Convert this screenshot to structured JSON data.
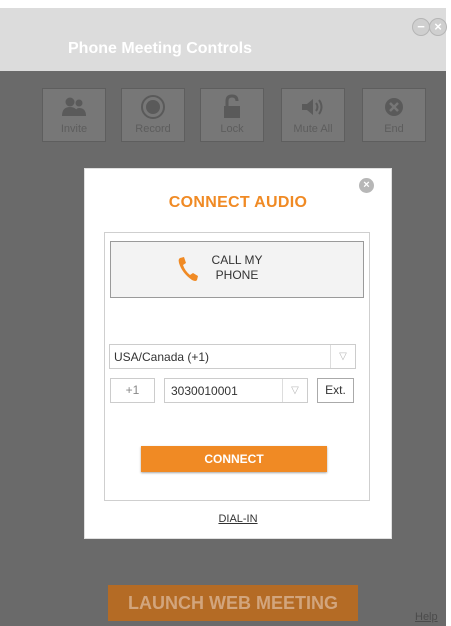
{
  "window": {
    "title": "Phone Meeting Controls",
    "minimize_symbol": "−",
    "close_symbol": "×"
  },
  "toolbar": {
    "items": [
      {
        "label": "Invite",
        "icon": "users-icon"
      },
      {
        "label": "Record",
        "icon": "record-icon"
      },
      {
        "label": "Lock",
        "icon": "unlock-icon"
      },
      {
        "label": "Mute All",
        "icon": "speaker-icon"
      },
      {
        "label": "End",
        "icon": "end-icon"
      }
    ]
  },
  "dialog": {
    "title": "CONNECT AUDIO",
    "close_symbol": "×",
    "call_my_phone_line1": "CALL MY",
    "call_my_phone_line2": "PHONE",
    "country_value": "USA/Canada (+1)",
    "country_code": "+1",
    "phone_number": "3030010001",
    "ext_label": "Ext.",
    "connect_label": "CONNECT",
    "dial_in_label": "DIAL-IN"
  },
  "footer": {
    "launch_label": "LAUNCH WEB MEETING",
    "help_label": "Help"
  },
  "colors": {
    "accent": "#f08a24",
    "overlay": "#6a6a6a"
  }
}
